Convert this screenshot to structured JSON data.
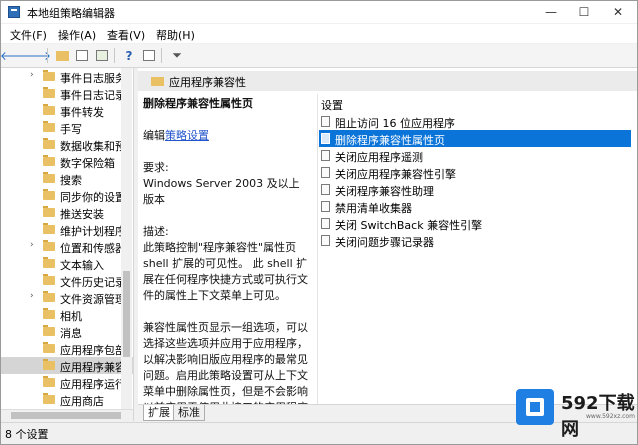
{
  "window": {
    "title": "本地组策略编辑器",
    "controls": {
      "minimize": "—",
      "maximize": "☐",
      "close": "✕"
    }
  },
  "menu": [
    "文件(F)",
    "操作(A)",
    "查看(V)",
    "帮助(H)"
  ],
  "toolbar": {
    "icons": [
      "back-icon",
      "forward-icon",
      "up-folder-icon",
      "show-hide-tree-icon",
      "export-list-icon",
      "help-icon",
      "properties-icon",
      "filter-icon"
    ]
  },
  "tree": {
    "items": [
      {
        "label": "事件日志服务",
        "arrow": "›",
        "selected": false
      },
      {
        "label": "事件日志记录",
        "arrow": "",
        "selected": false
      },
      {
        "label": "事件转发",
        "arrow": "",
        "selected": false
      },
      {
        "label": "手写",
        "arrow": "",
        "selected": false
      },
      {
        "label": "数据收集和预",
        "arrow": "",
        "selected": false
      },
      {
        "label": "数字保险箱",
        "arrow": "",
        "selected": false
      },
      {
        "label": "搜索",
        "arrow": "",
        "selected": false
      },
      {
        "label": "同步你的设置",
        "arrow": "",
        "selected": false
      },
      {
        "label": "推送安装",
        "arrow": "",
        "selected": false
      },
      {
        "label": "维护计划程序",
        "arrow": "",
        "selected": false
      },
      {
        "label": "位置和传感器",
        "arrow": "›",
        "selected": false
      },
      {
        "label": "文本输入",
        "arrow": "",
        "selected": false
      },
      {
        "label": "文件历史记录",
        "arrow": "",
        "selected": false
      },
      {
        "label": "文件资源管理",
        "arrow": "›",
        "selected": false
      },
      {
        "label": "相机",
        "arrow": "",
        "selected": false
      },
      {
        "label": "消息",
        "arrow": "",
        "selected": false
      },
      {
        "label": "应用程序包部",
        "arrow": "",
        "selected": false
      },
      {
        "label": "应用程序兼容",
        "arrow": "",
        "selected": true
      },
      {
        "label": "应用程序运行",
        "arrow": "",
        "selected": false
      },
      {
        "label": "应用商店",
        "arrow": "",
        "selected": false
      }
    ]
  },
  "pane": {
    "header": "应用程序兼容性",
    "column_header": "设置",
    "description": {
      "title": "删除程序兼容性属性页",
      "edit_prefix": "编辑",
      "edit_link": "策略设置",
      "requirements_label": "要求:",
      "requirements_value": "Windows Server 2003 及以上版本",
      "desc_label": "描述:",
      "desc_text": "此策略控制\"程序兼容性\"属性页 shell 扩展的可见性。 此 shell 扩展在任何程序快捷方式或可执行文件的属性上下文菜单上可见。",
      "desc_text2": "兼容性属性页显示一组选项，可以选择这些选项并应用于应用程序，以解决影响旧版应用程序的最常见问题。启用此策略设置可从上下文菜单中删除属性页，但是不会影响以前应用于使用此接口的应用程序的兼容性设置。"
    },
    "settings": [
      {
        "label": "阻止访问 16 位应用程序",
        "selected": false
      },
      {
        "label": "删除程序兼容性属性页",
        "selected": true
      },
      {
        "label": "关闭应用程序遥测",
        "selected": false
      },
      {
        "label": "关闭应用程序兼容性引擎",
        "selected": false
      },
      {
        "label": "关闭程序兼容性助理",
        "selected": false
      },
      {
        "label": "禁用清单收集器",
        "selected": false
      },
      {
        "label": "关闭 SwitchBack 兼容性引擎",
        "selected": false
      },
      {
        "label": "关闭问题步骤记录器",
        "selected": false
      }
    ],
    "tabs": [
      "扩展",
      "标准"
    ]
  },
  "status": "8 个设置",
  "watermark": {
    "text": "592下载网",
    "sub": "www.592xz.com"
  }
}
